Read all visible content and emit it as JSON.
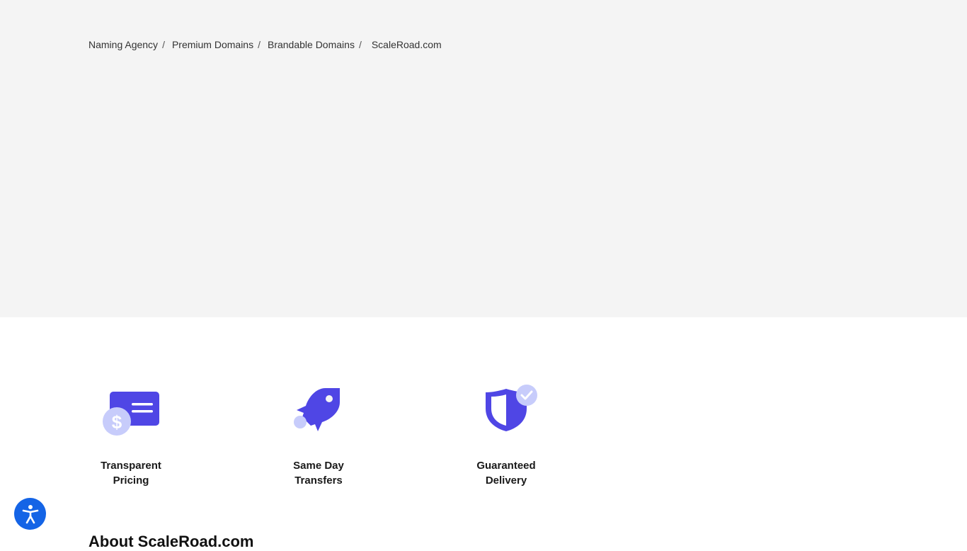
{
  "breadcrumb": {
    "items": [
      {
        "label": "Naming Agency"
      },
      {
        "label": "Premium Domains"
      },
      {
        "label": "Brandable Domains"
      }
    ],
    "separator": "/",
    "current": "ScaleRoad.com"
  },
  "features": [
    {
      "icon": "pricing-icon",
      "line1": "Transparent",
      "line2": "Pricing"
    },
    {
      "icon": "rocket-icon",
      "line1": "Same Day",
      "line2": "Transfers"
    },
    {
      "icon": "shield-check-icon",
      "line1": "Guaranteed",
      "line2": "Delivery"
    }
  ],
  "about": {
    "title": "About ScaleRoad.com"
  },
  "accessibility": {
    "icon": "accessibility-icon"
  },
  "colors": {
    "hero_bg": "#f4f4f4",
    "icon_primary": "#4f46e5",
    "icon_light": "#c7ccfb",
    "accessibility_bg": "#1464e6"
  }
}
